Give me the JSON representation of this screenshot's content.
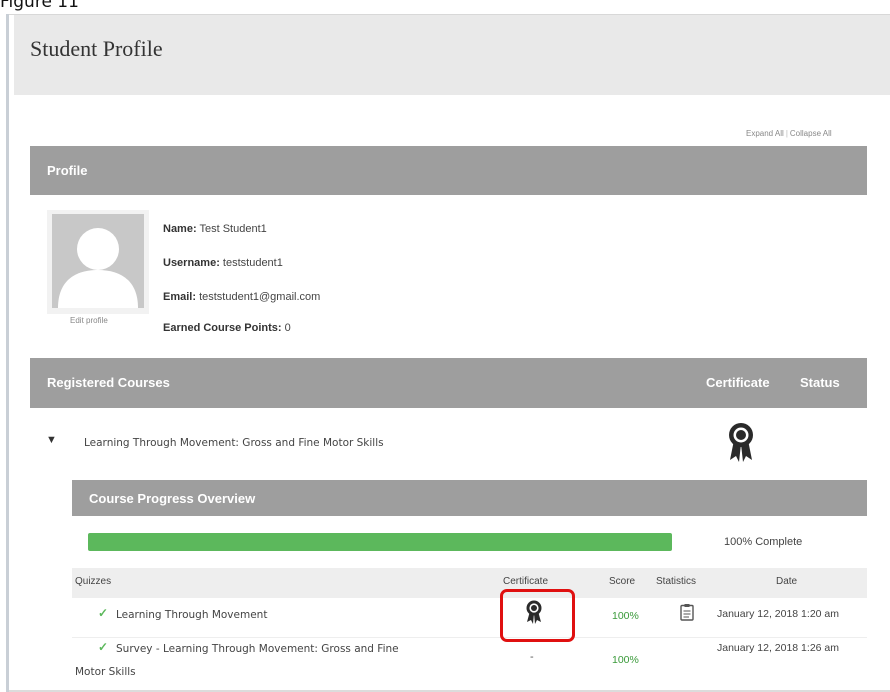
{
  "figure_caption": "Figure 11",
  "page": {
    "title": "Student Profile",
    "expand_all": "Expand All",
    "collapse_all": "Collapse All"
  },
  "profile": {
    "section_title": "Profile",
    "edit_profile_label": "Edit profile",
    "name_label": "Name:",
    "name_value": "Test Student1",
    "username_label": "Username:",
    "username_value": "teststudent1",
    "email_label": "Email:",
    "email_value": "teststudent1@gmail.com",
    "points_label": "Earned Course Points:",
    "points_value": "0"
  },
  "registered_courses": {
    "section_title": "Registered Courses",
    "col_certificate": "Certificate",
    "col_status": "Status",
    "courses": [
      {
        "name": "Learning Through Movement: Gross and Fine Motor Skills",
        "certificate_icon": "award-ribbon-icon"
      }
    ]
  },
  "progress": {
    "title": "Course Progress Overview",
    "percent": 100,
    "text": "100% Complete",
    "fill_color": "#5cb85c"
  },
  "quizzes": {
    "headers": {
      "quizzes": "Quizzes",
      "certificate": "Certificate",
      "score": "Score",
      "statistics": "Statistics",
      "date": "Date"
    },
    "rows": [
      {
        "name": "Learning Through Movement",
        "certificate": "award-ribbon-icon",
        "score": "100%",
        "statistics": "clipboard-icon",
        "date": "January 12, 2018 1:20 am"
      },
      {
        "name_line1": "Survey - Learning Through Movement: Gross and Fine",
        "name_line2": "Motor Skills",
        "certificate": "-",
        "score": "100%",
        "date": "January 12, 2018 1:26 am"
      }
    ]
  },
  "colors": {
    "bar": "#9e9e9e",
    "accent_green": "#5cb85c",
    "highlight": "#e01010"
  }
}
